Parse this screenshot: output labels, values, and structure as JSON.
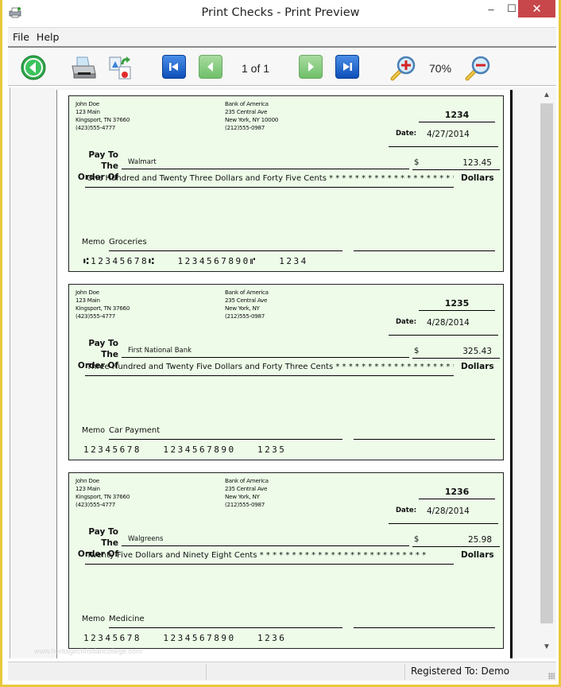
{
  "window": {
    "title": "Print Checks - Print Preview",
    "controls": {
      "minimize": "–",
      "maximize": "☐",
      "close": "✕"
    }
  },
  "menu": {
    "items": [
      {
        "label": "File"
      },
      {
        "label": "Help"
      }
    ]
  },
  "toolbar": {
    "buttons": [
      {
        "name": "back",
        "icon": "back-arrow-icon"
      },
      {
        "name": "print",
        "icon": "printer-icon"
      },
      {
        "name": "export",
        "icon": "export-icon"
      },
      {
        "name": "first-page",
        "icon": "first-page-icon"
      },
      {
        "name": "previous-page",
        "icon": "previous-page-icon"
      },
      {
        "name": "next-page",
        "icon": "next-page-icon"
      },
      {
        "name": "last-page",
        "icon": "last-page-icon"
      },
      {
        "name": "zoom-in",
        "icon": "zoom-in-icon"
      },
      {
        "name": "zoom-out",
        "icon": "zoom-out-icon"
      }
    ],
    "page_label": "1 of 1",
    "zoom_label": "70%"
  },
  "checks": [
    {
      "payer": {
        "name": "John Doe",
        "street": "123 Main",
        "city": "Kingsport, TN 37660",
        "phone": "(423)555-4777"
      },
      "bank": {
        "name": "Bank of America",
        "street": "235 Central Ave",
        "city": "New York, NY 10000",
        "phone": "(212)555-0987"
      },
      "number": "1234",
      "date_label": "Date:",
      "date": "4/27/2014",
      "pay_label_1": "Pay To The",
      "pay_label_2": "Order Of",
      "payee": "Walmart",
      "currency": "$",
      "amount": "123.45",
      "amount_words": "One Hundred and Twenty Three Dollars and Forty Five Cents * * * * * * * * * * * * * * * * * * * *",
      "dollars_label": "Dollars",
      "memo_label": "Memo",
      "memo": "Groceries",
      "micr": "⑆12345678⑆   1234567890⑈   1234"
    },
    {
      "payer": {
        "name": "John Doe",
        "street": "123 Main",
        "city": "Kingsport, TN 37660",
        "phone": "(423)555-4777"
      },
      "bank": {
        "name": "Bank of America",
        "street": "235 Central Ave",
        "city": "New York, NY",
        "phone": "(212)555-0987"
      },
      "number": "1235",
      "date_label": "Date:",
      "date": "4/28/2014",
      "pay_label_1": "Pay To The",
      "pay_label_2": "Order Of",
      "payee": "First National Bank",
      "currency": "$",
      "amount": "325.43",
      "amount_words": "Three Hundred and Twenty Five Dollars and Forty Three Cents * * * * * * * * * * * * * * * * * * *",
      "dollars_label": "Dollars",
      "memo_label": "Memo",
      "memo": "Car Payment",
      "micr": "12345678   1234567890   1235"
    },
    {
      "payer": {
        "name": "John Doe",
        "street": "123 Main",
        "city": "Kingsport, TN 37660",
        "phone": "(423)555-4777"
      },
      "bank": {
        "name": "Bank of America",
        "street": "235 Central Ave",
        "city": "New York, NY",
        "phone": "(212)555-0987"
      },
      "number": "1236",
      "date_label": "Date:",
      "date": "4/28/2014",
      "pay_label_1": "Pay To The",
      "pay_label_2": "Order Of",
      "payee": "Walgreens",
      "currency": "$",
      "amount": "25.98",
      "amount_words": "Twenty Five Dollars and Ninety Eight Cents * * * * * * * * * * * * * * * * * * * * * * * * * *",
      "dollars_label": "Dollars",
      "memo_label": "Memo",
      "memo": "Medicine",
      "micr": "12345678   1234567890   1236"
    }
  ],
  "watermark": "www.heritagechristiancollege.com",
  "status": {
    "registered": "Registered To: Demo"
  },
  "colors": {
    "check_background": "#edfbe8",
    "close_button": "#c7474b",
    "nav_blue": "#0d4fb8",
    "nav_green": "#6fbf69"
  }
}
